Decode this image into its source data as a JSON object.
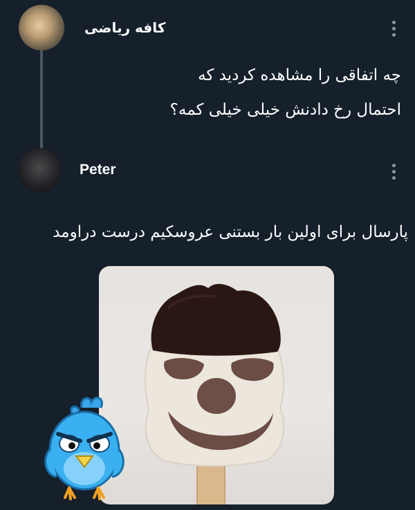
{
  "tweets": [
    {
      "author": "کافه ریاضی",
      "lines": [
        "چه اتفاقی را مشاهده کردید که",
        "احتمال رخ دادنش خیلی خیلی کمه؟"
      ]
    },
    {
      "author": "Peter",
      "text": "پارسال برای اولین بار بستنی عروسکیم درست دراومد"
    }
  ],
  "icons": {
    "more": "kebab-menu-icon",
    "sticker": "angry-bird-sticker"
  },
  "colors": {
    "background": "#15202b",
    "text": "#ffffff",
    "thread_line": "#4a5866",
    "muted": "#8b98a5"
  }
}
